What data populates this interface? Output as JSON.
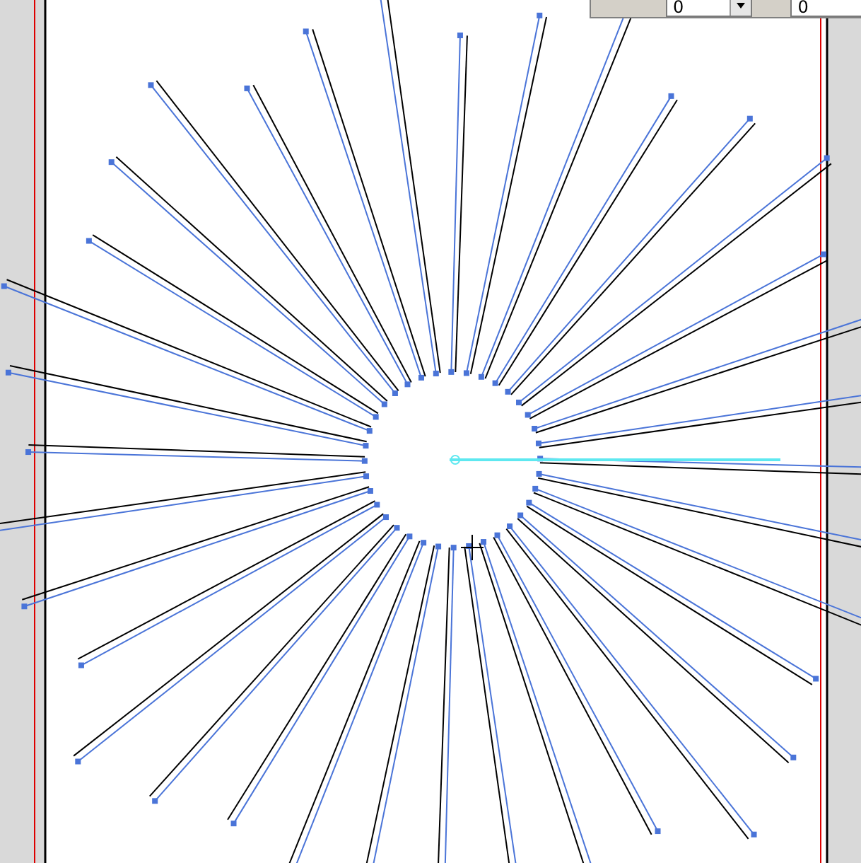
{
  "panel": {
    "fields": [
      {
        "kind": "dropdown",
        "value": "0"
      },
      {
        "kind": "text",
        "value": "0"
      }
    ]
  }
}
